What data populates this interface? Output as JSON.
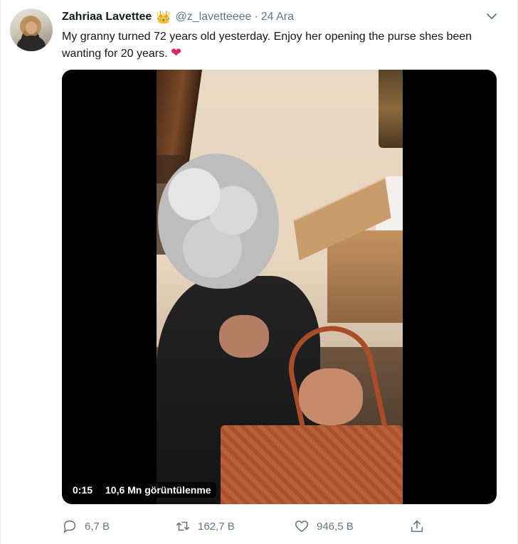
{
  "tweet": {
    "author_name": "Zahriaa Lavettee",
    "author_emoji": "👑",
    "handle": "@z_lavetteeee",
    "separator": "·",
    "date": "24 Ara",
    "text": "My granny turned 72 years old yesterday. Enjoy her opening the purse shes been wanting for 20 years.",
    "text_emoji": "❤"
  },
  "video": {
    "timestamp": "0:15",
    "views": "10,6 Mn görüntülenme"
  },
  "actions": {
    "replies": "6,7 B",
    "retweets": "162,7 B",
    "likes": "946,5 B"
  },
  "icons": {
    "more": "chevron-down-icon",
    "reply": "reply-icon",
    "retweet": "retweet-icon",
    "like": "heart-icon",
    "share": "share-icon"
  },
  "colors": {
    "text": "#14171a",
    "muted": "#657786",
    "heart": "#e0245e",
    "crown": "#f4b400"
  }
}
